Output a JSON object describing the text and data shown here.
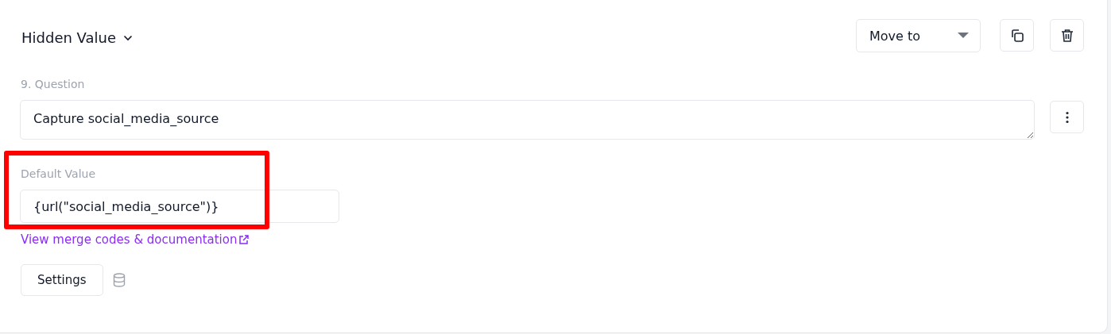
{
  "block": {
    "title": "Hidden Value",
    "move_to": {
      "label": "Move to"
    },
    "question": {
      "label": "9. Question",
      "value": "Capture social_media_source"
    },
    "default_value": {
      "label": "Default Value",
      "value": "{url(\"social_media_source\")}",
      "highlighted": true
    },
    "link": "View merge codes & documentation",
    "settings_button": "Settings"
  }
}
